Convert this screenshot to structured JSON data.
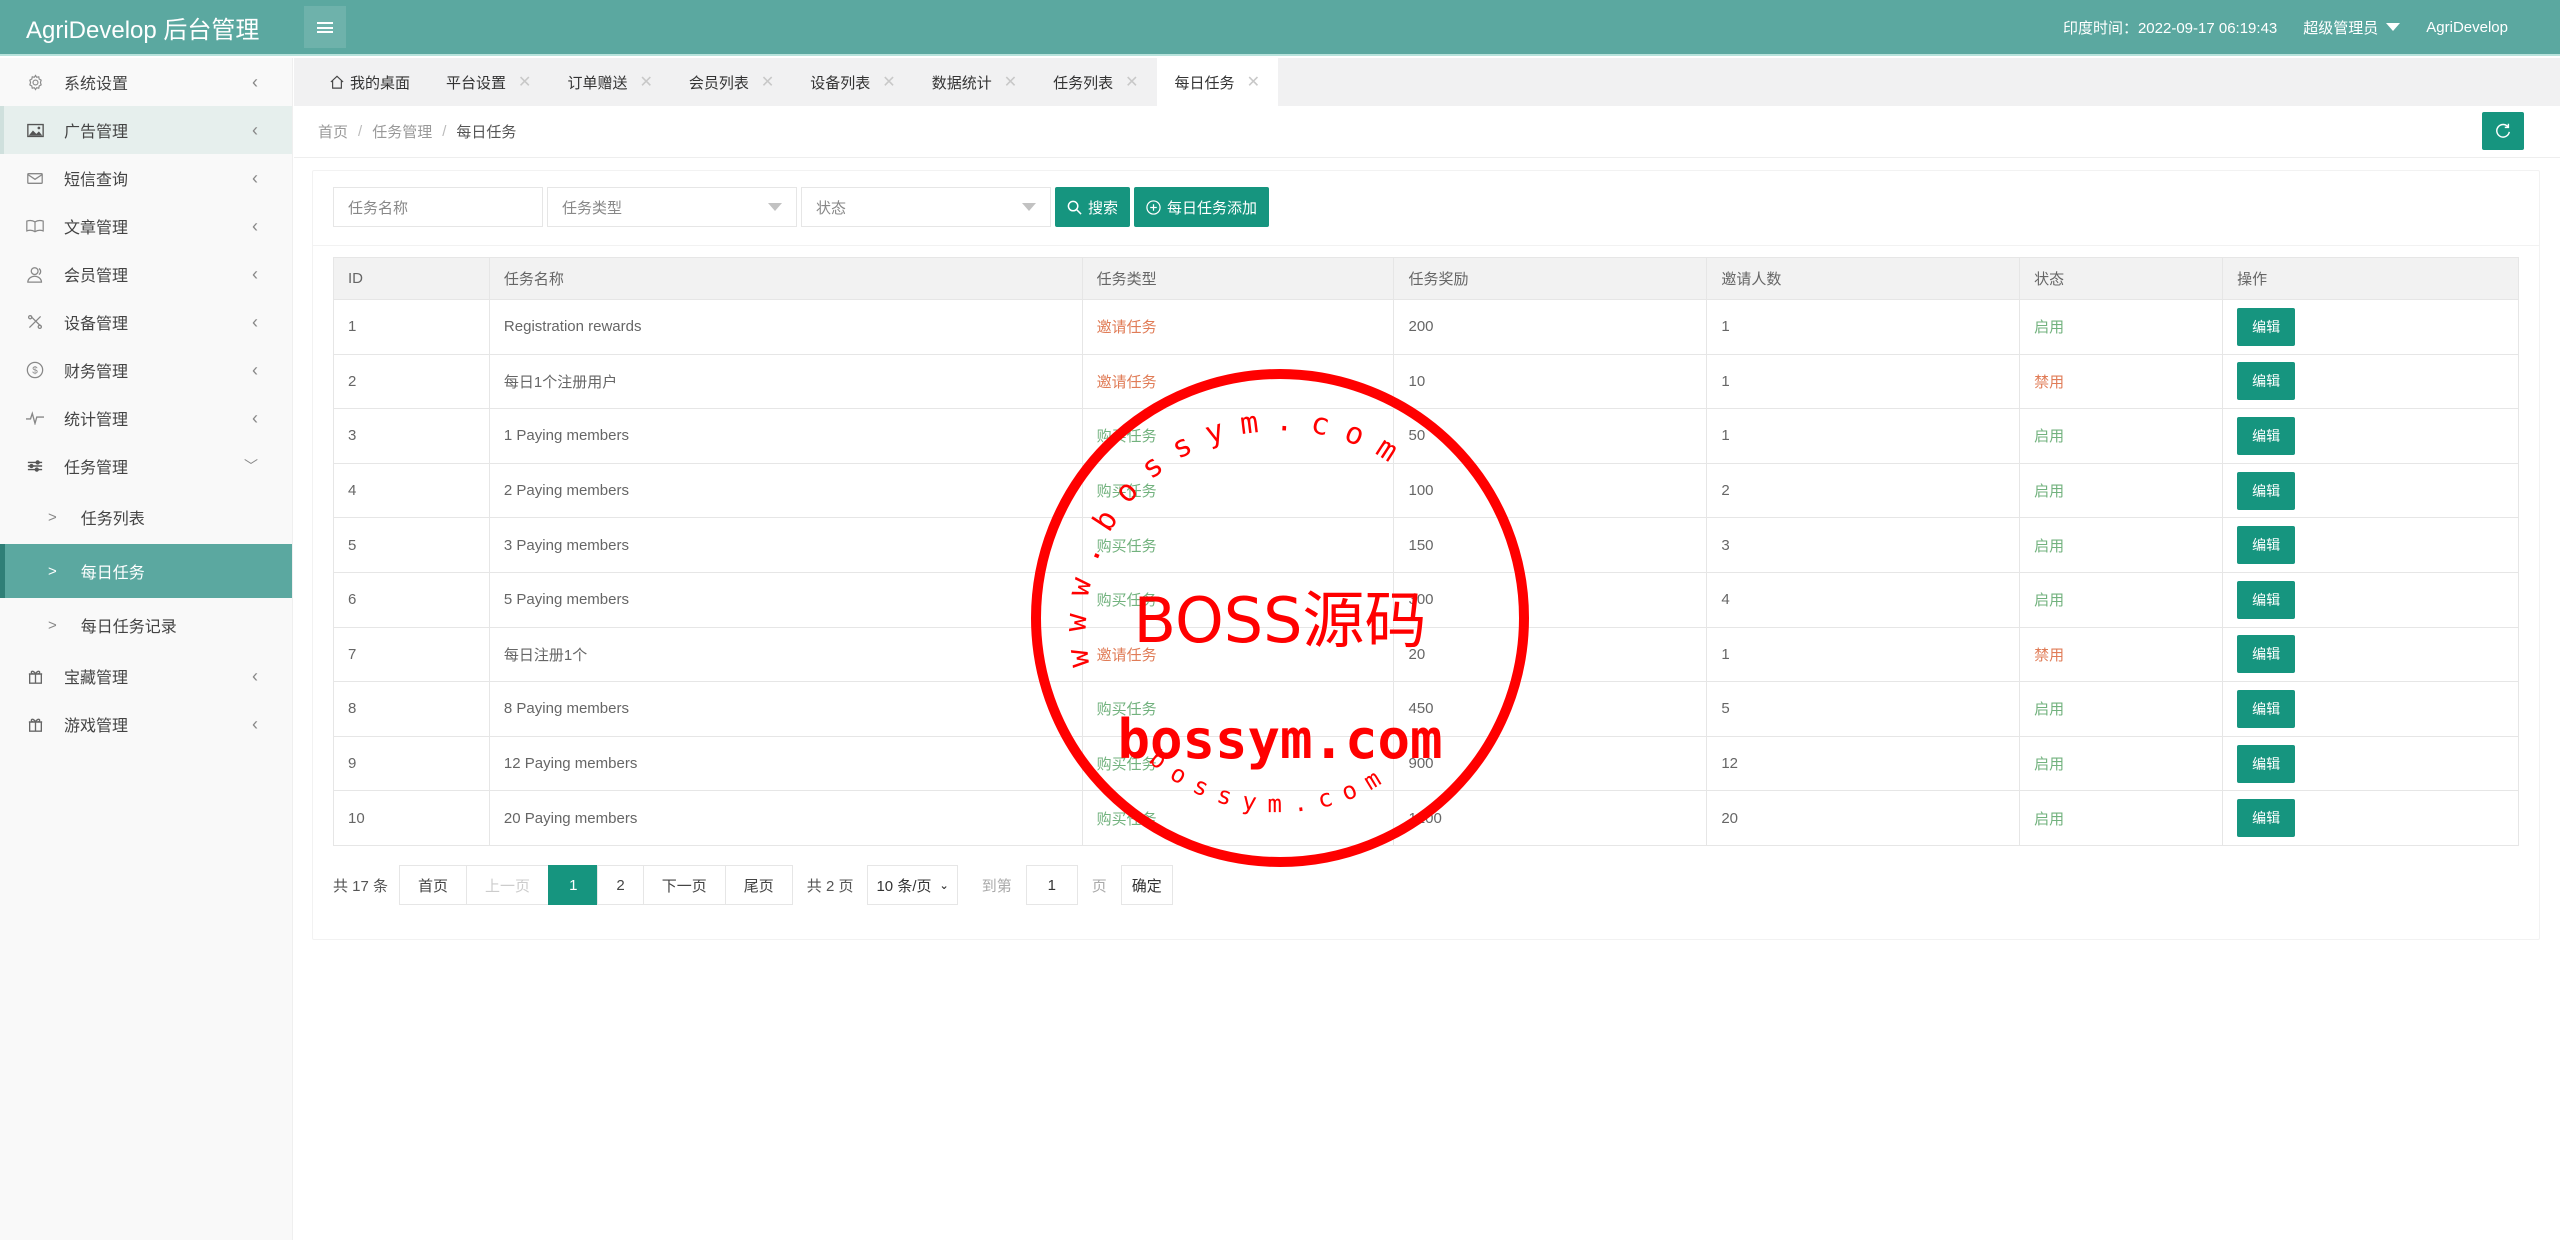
{
  "header": {
    "app_title": "AgriDevelop 后台管理",
    "time_label": "印度时间：2022-09-17 06:19:43",
    "role_label": "超级管理员",
    "username": "AgriDevelop"
  },
  "sidebar": {
    "items": [
      {
        "label": "系统设置",
        "icon": "gear-icon"
      },
      {
        "label": "广告管理",
        "icon": "image-icon"
      },
      {
        "label": "短信查询",
        "icon": "mail-icon"
      },
      {
        "label": "文章管理",
        "icon": "book-icon"
      },
      {
        "label": "会员管理",
        "icon": "user-icon"
      },
      {
        "label": "设备管理",
        "icon": "tools-icon"
      },
      {
        "label": "财务管理",
        "icon": "dollar-icon"
      },
      {
        "label": "统计管理",
        "icon": "pulse-icon"
      },
      {
        "label": "任务管理",
        "icon": "sliders-icon"
      },
      {
        "label": "宝藏管理",
        "icon": "gift-icon"
      },
      {
        "label": "游戏管理",
        "icon": "gift-icon"
      }
    ],
    "task_sub_items": [
      {
        "label": "任务列表"
      },
      {
        "label": "每日任务"
      },
      {
        "label": "每日任务记录"
      }
    ]
  },
  "tabs": [
    {
      "label": "我的桌面"
    },
    {
      "label": "平台设置"
    },
    {
      "label": "订单赠送"
    },
    {
      "label": "会员列表"
    },
    {
      "label": "设备列表"
    },
    {
      "label": "数据统计"
    },
    {
      "label": "任务列表"
    },
    {
      "label": "每日任务"
    }
  ],
  "breadcrumb": {
    "home": "首页",
    "section": "任务管理",
    "current": "每日任务",
    "separator": "/"
  },
  "search": {
    "name_placeholder": "任务名称",
    "type_placeholder": "任务类型",
    "status_placeholder": "状态",
    "search_label": "搜索",
    "add_label": "每日任务添加"
  },
  "table": {
    "columns": [
      "ID",
      "任务名称",
      "任务类型",
      "任务奖励",
      "邀请人数",
      "状态",
      "操作"
    ],
    "edit_label": "编辑",
    "rows": [
      {
        "id": "1",
        "name": "Registration rewards",
        "type": "邀请任务",
        "reward": "200",
        "invites": "1",
        "status": "启用"
      },
      {
        "id": "2",
        "name": "每日1个注册用户",
        "type": "邀请任务",
        "reward": "10",
        "invites": "1",
        "status": "禁用"
      },
      {
        "id": "3",
        "name": "1 Paying members",
        "type": "购买任务",
        "reward": "50",
        "invites": "1",
        "status": "启用"
      },
      {
        "id": "4",
        "name": "2 Paying members",
        "type": "购买任务",
        "reward": "100",
        "invites": "2",
        "status": "启用"
      },
      {
        "id": "5",
        "name": "3 Paying members",
        "type": "购买任务",
        "reward": "150",
        "invites": "3",
        "status": "启用"
      },
      {
        "id": "6",
        "name": "5 Paying members",
        "type": "购买任务",
        "reward": "300",
        "invites": "4",
        "status": "启用"
      },
      {
        "id": "7",
        "name": "每日注册1个",
        "type": "邀请任务",
        "reward": "20",
        "invites": "1",
        "status": "禁用"
      },
      {
        "id": "8",
        "name": "8 Paying members",
        "type": "购买任务",
        "reward": "450",
        "invites": "5",
        "status": "启用"
      },
      {
        "id": "9",
        "name": "12 Paying members",
        "type": "购买任务",
        "reward": "900",
        "invites": "12",
        "status": "启用"
      },
      {
        "id": "10",
        "name": "20 Paying members",
        "type": "购买任务",
        "reward": "1200",
        "invites": "20",
        "status": "启用"
      }
    ]
  },
  "pagination": {
    "total": "共 17 条",
    "first": "首页",
    "prev": "上一页",
    "pages": [
      "1",
      "2"
    ],
    "current_page": "1",
    "next": "下一页",
    "last": "尾页",
    "page_count": "共 2 页",
    "limit": "10 条/页",
    "goto_label": "到第",
    "goto_value": "1",
    "page_suffix": "页",
    "confirm": "确定"
  },
  "watermark": {
    "center_text": "BOSS源码",
    "domain_text": "bossym.com",
    "ring_top_text": "www.bossym.com",
    "ring_bottom_text": "bossym.com"
  },
  "colors": {
    "header_bg": "#5ba8a0",
    "primary_button": "#16957f",
    "status_enabled": "#72b27e",
    "status_disabled": "#e07c57",
    "stamp_red": "#ff0000"
  }
}
